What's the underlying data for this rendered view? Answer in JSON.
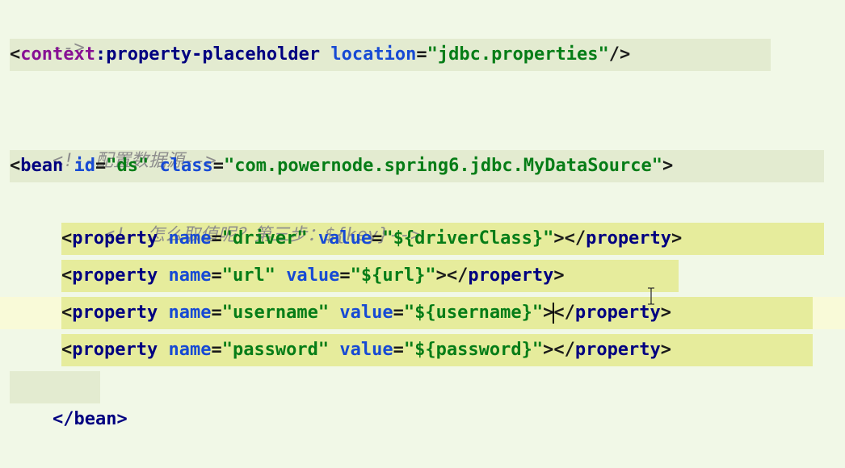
{
  "editor": {
    "lines": {
      "l0": {
        "text": "-->"
      },
      "l1": {
        "open": "<",
        "ns": "context",
        "colon": ":",
        "tag": "property-placeholder",
        "attr": "location",
        "eq": "=",
        "val": "\"jdbc.properties\"",
        "close": "/>"
      },
      "l3": {
        "text": "<!--配置数据源-->"
      },
      "l4": {
        "open": "<",
        "tag": "bean",
        "attr1": "id",
        "val1": "\"ds\"",
        "attr2": "class",
        "val2": "\"com.powernode.spring6.jdbc.MyDataSource\"",
        "close": ">"
      },
      "l5": {
        "text": "<!--怎么取值呢？第三步：${key}-->"
      },
      "l6": {
        "name_attr": "name",
        "name_val": "\"driver\"",
        "value_attr": "value",
        "value_val": "\"${driverClass}\""
      },
      "l7": {
        "name_attr": "name",
        "name_val": "\"url\"",
        "value_attr": "value",
        "value_val": "\"${url}\""
      },
      "l8": {
        "name_attr": "name",
        "name_val": "\"username\"",
        "value_attr": "value",
        "value_val": "\"${username}\""
      },
      "l9": {
        "name_attr": "name",
        "name_val": "\"password\"",
        "value_attr": "value",
        "value_val": "\"${password}\""
      },
      "l10": {
        "text": "</bean>"
      }
    },
    "property": {
      "open": "<",
      "tag": "property",
      "gt": ">",
      "close_open": "</",
      "close_tag": "property",
      "close_gt": ">",
      "eq": "="
    },
    "cursor_icon": "text-cursor-ibeam-icon",
    "colors": {
      "background": "#f1f8e7",
      "tag": "#000080",
      "namespace": "#871094",
      "attribute": "#174ad4",
      "value": "#067d17",
      "comment": "#8d8d8d",
      "highlight_block": "#e6ec9c",
      "current_line": "#f9fad8"
    }
  }
}
